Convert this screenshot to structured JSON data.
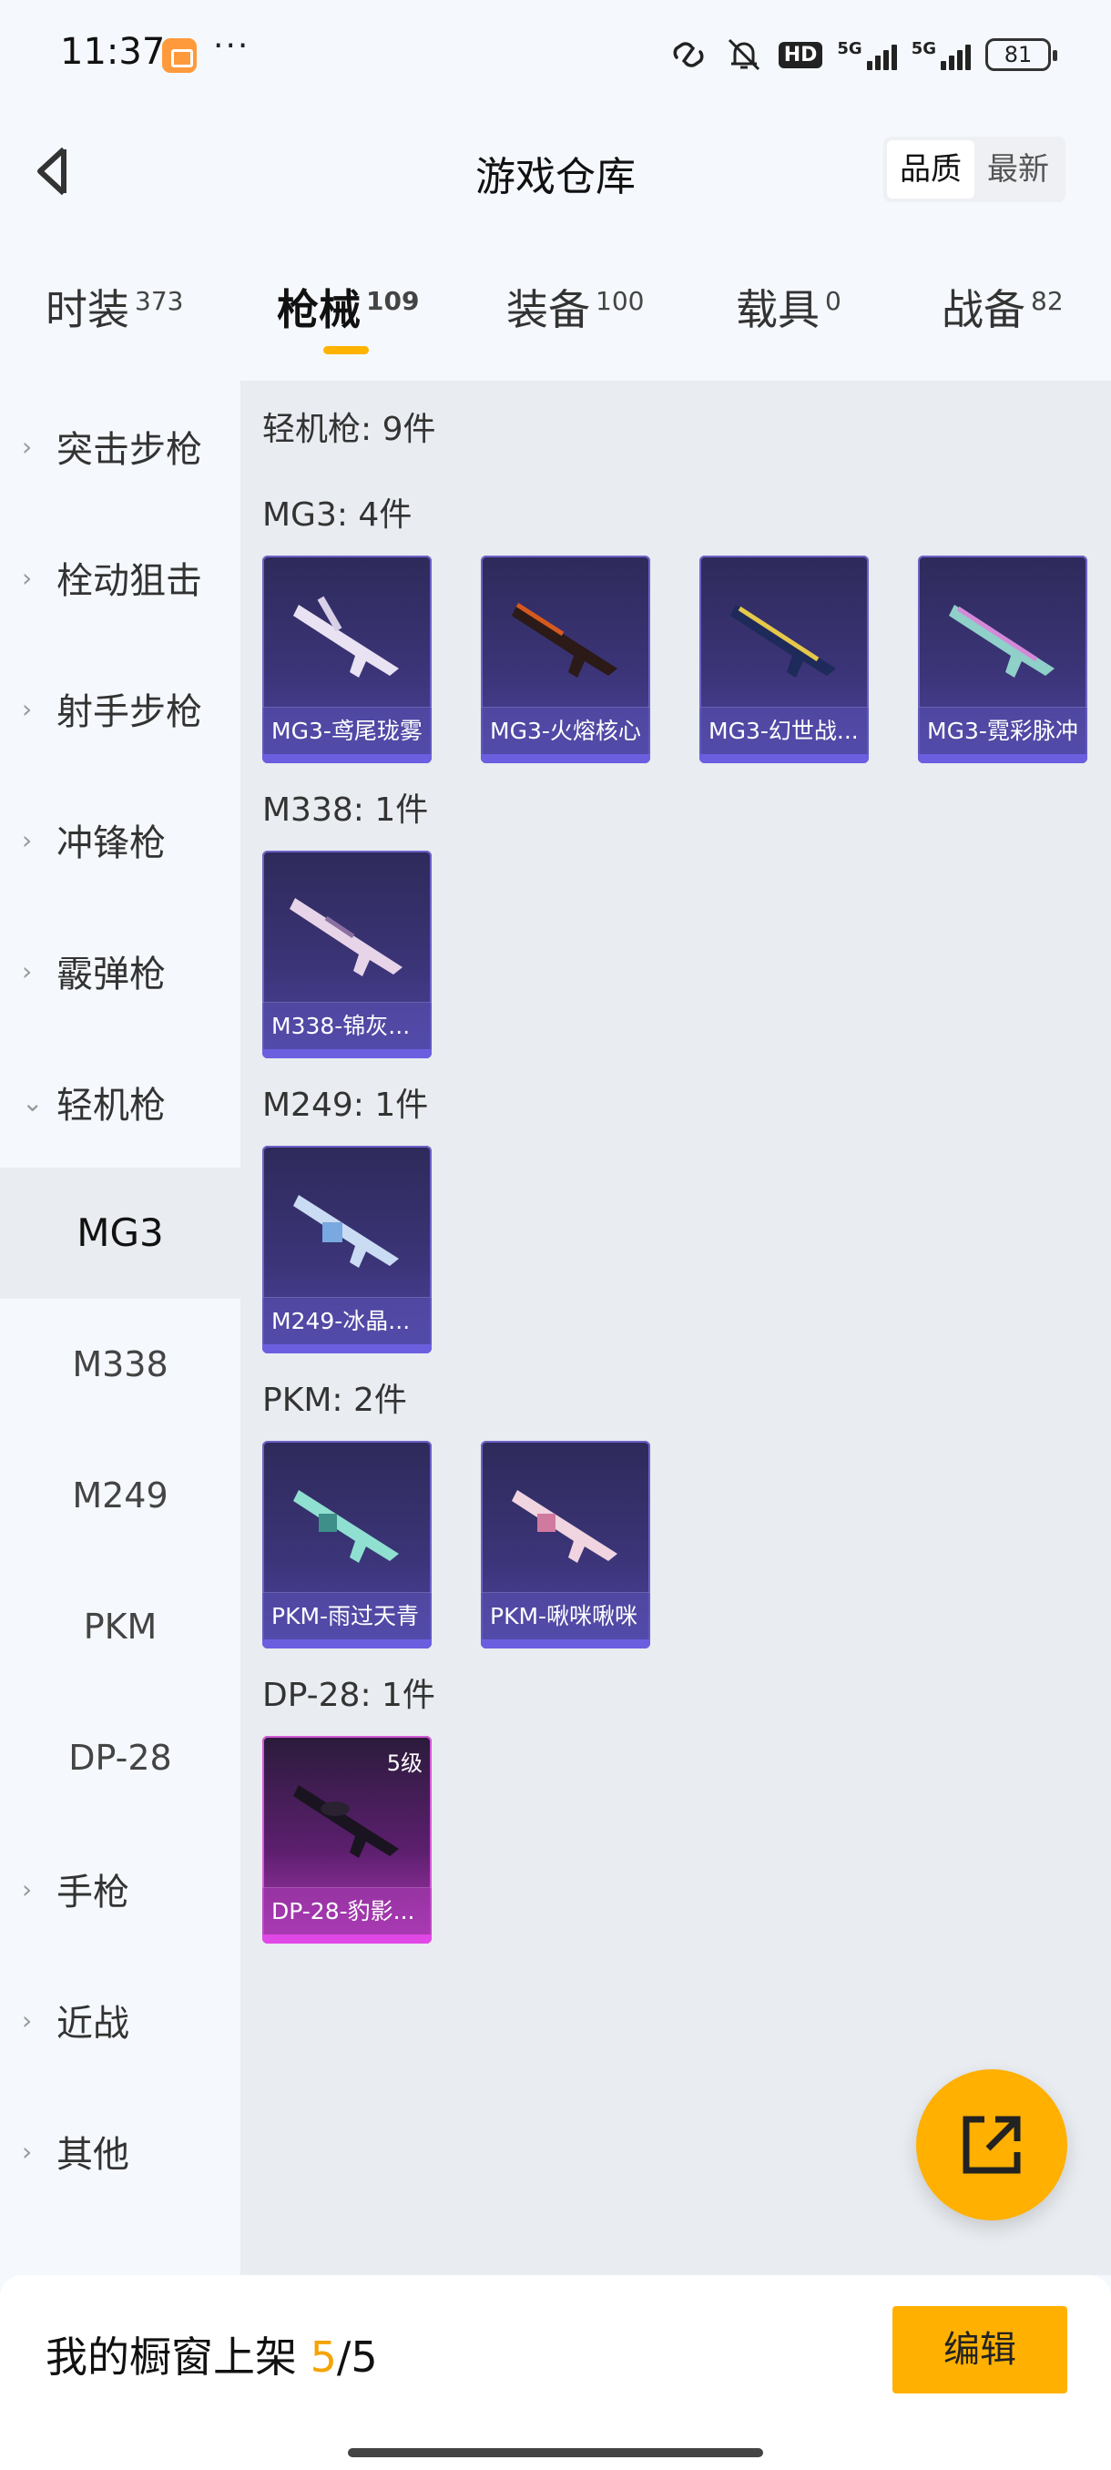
{
  "status_bar": {
    "time": "11:37",
    "dots": "···",
    "hd": "HD",
    "sig1": "5G",
    "sig2": "5G",
    "battery": "81"
  },
  "header": {
    "title": "游戏仓库",
    "sort_options": [
      "品质",
      "最新"
    ],
    "active_sort": "品质"
  },
  "tabs": [
    {
      "label": "时装",
      "count": "373"
    },
    {
      "label": "枪械",
      "count": "109",
      "active": true
    },
    {
      "label": "装备",
      "count": "100"
    },
    {
      "label": "载具",
      "count": "0"
    },
    {
      "label": "战备",
      "count": "82"
    }
  ],
  "sidebar": {
    "categories": [
      "突击步枪",
      "栓动狙击",
      "射手步枪",
      "冲锋枪",
      "霰弹枪",
      "轻机枪",
      "手枪",
      "近战",
      "其他"
    ],
    "expanded": "轻机枪",
    "subitems": [
      "MG3",
      "M338",
      "M249",
      "PKM",
      "DP-28"
    ],
    "active_sub": "MG3"
  },
  "main": {
    "section_title": "轻机枪: 9件",
    "groups": [
      {
        "label": "MG3: 4件",
        "items": [
          {
            "name": "MG3-鸢尾珑雾",
            "icon": "lmg-icon"
          },
          {
            "name": "MG3-火熔核心",
            "icon": "lmg-icon"
          },
          {
            "name": "MG3-幻世战...",
            "icon": "lmg-icon"
          },
          {
            "name": "MG3-霓彩脉冲",
            "icon": "lmg-icon"
          }
        ]
      },
      {
        "label": "M338: 1件",
        "items": [
          {
            "name": "M338-锦灰...",
            "icon": "rifle-icon"
          }
        ]
      },
      {
        "label": "M249: 1件",
        "items": [
          {
            "name": "M249-冰晶...",
            "icon": "lmg-icon"
          }
        ]
      },
      {
        "label": "PKM: 2件",
        "items": [
          {
            "name": "PKM-雨过天青",
            "icon": "lmg-icon"
          },
          {
            "name": "PKM-啾咪啾咪",
            "icon": "lmg-icon"
          }
        ]
      },
      {
        "label": "DP-28: 1件",
        "items": [
          {
            "name": "DP-28-豹影...",
            "icon": "lmg-icon",
            "level": "5级"
          }
        ]
      }
    ]
  },
  "bottom_bar": {
    "showcase_prefix": "我的橱窗上架 ",
    "showcase_used": "5",
    "showcase_sep": "/",
    "showcase_total": "5",
    "edit_label": "编辑"
  },
  "colors": {
    "accent": "#ffb000",
    "card_blue": "#3b3477",
    "card_pink": "#b13ab8"
  }
}
